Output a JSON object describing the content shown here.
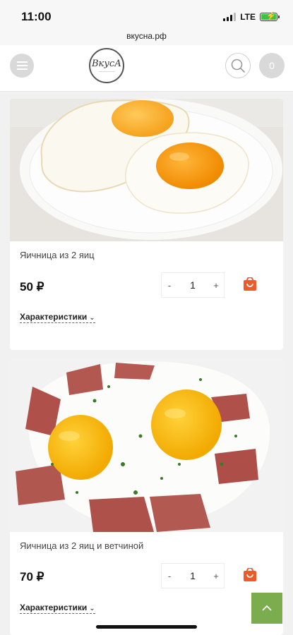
{
  "status_bar": {
    "time": "11:00",
    "network": "LTE"
  },
  "browser": {
    "url": "вкусна.рф"
  },
  "header": {
    "logo_text": "ВкусА",
    "cart_count": "0"
  },
  "products": [
    {
      "name": "Яичница из 2 яиц",
      "price": "50 ₽",
      "quantity": "1",
      "minus": "-",
      "plus": "+",
      "specs_label": "Характеристики"
    },
    {
      "name": "Яичница из 2 яиц и ветчиной",
      "price": "70 ₽",
      "quantity": "1",
      "minus": "-",
      "plus": "+",
      "specs_label": "Характеристики"
    }
  ],
  "colors": {
    "accent_orange": "#ef5a2a",
    "scroll_button": "#7bac4e",
    "battery": "#3cc23f"
  },
  "icons": [
    "menu-icon",
    "search-icon",
    "cart-add-icon",
    "chevron-down-icon",
    "chevron-up-icon"
  ]
}
